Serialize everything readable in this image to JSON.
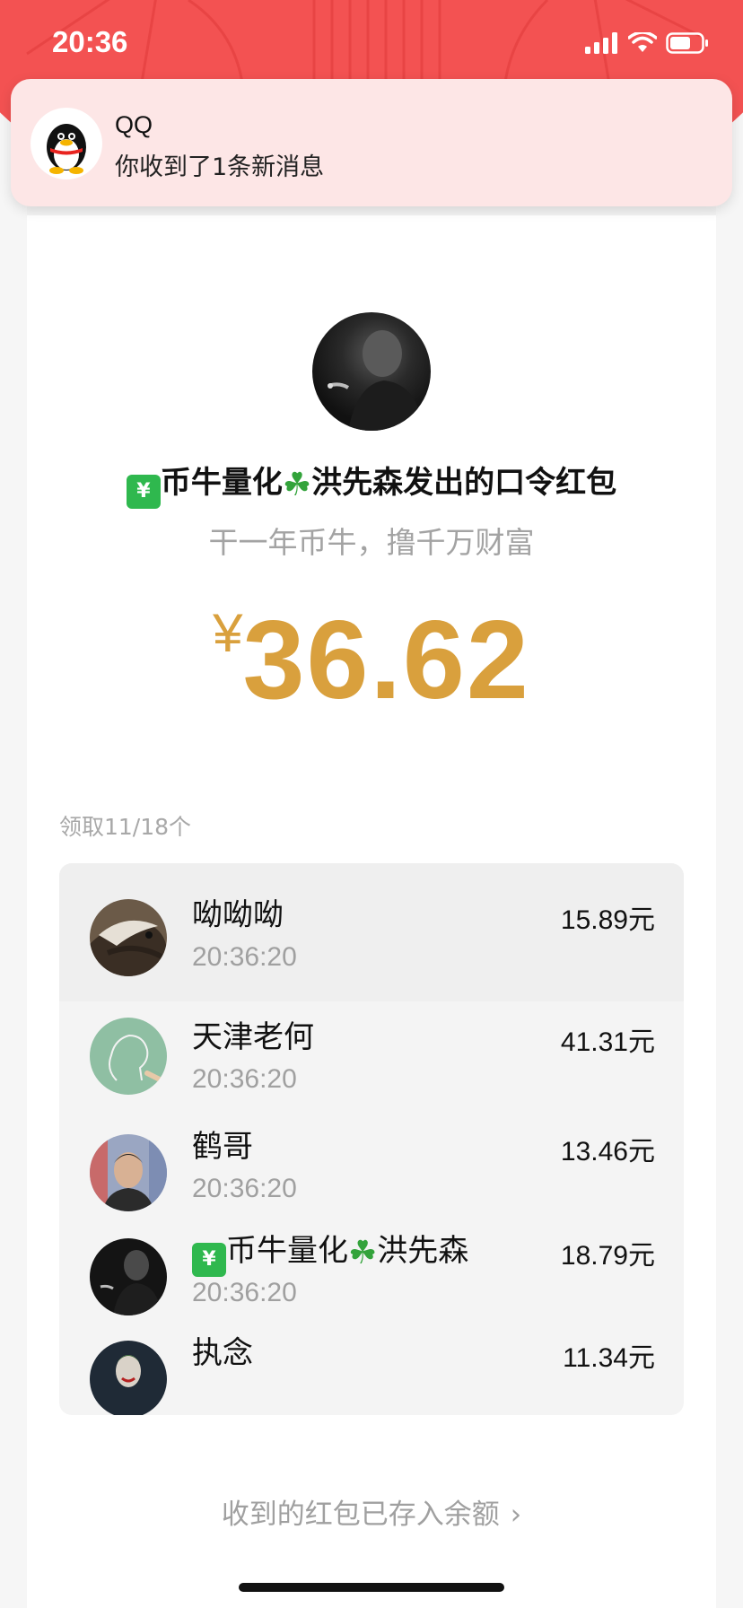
{
  "status_bar": {
    "time": "20:36"
  },
  "notification": {
    "app": "QQ",
    "message": "你收到了1条新消息",
    "icon": "qq-penguin-icon"
  },
  "packet": {
    "sender_title_prefix": "币牛量化",
    "sender_title_name": "洪先森",
    "sender_title_suffix": "发出的口令红包",
    "greeting": "干一年币牛，撸千万财富",
    "currency": "¥",
    "amount": "36.62",
    "claim_count": "领取11/18个",
    "badge_icon": "chart-badge-icon",
    "clover_icon": "four-leaf-clover-icon",
    "accent_color": "#d9a03d",
    "header_color": "#f35252"
  },
  "claims": [
    {
      "name": "呦呦呦",
      "time": "20:36:20",
      "amount": "15.89元",
      "avatar": "wolf-photo-avatar"
    },
    {
      "name": "天津老何",
      "time": "20:36:20",
      "amount": "41.31元",
      "avatar": "chalk-drawing-avatar"
    },
    {
      "name": "鹤哥",
      "time": "20:36:20",
      "amount": "13.46元",
      "avatar": "man-photo-avatar"
    },
    {
      "name_prefix": "币牛量化",
      "name_suffix": "洪先森",
      "time": "20:36:20",
      "amount": "18.79元",
      "avatar": "smoking-man-avatar"
    },
    {
      "name": "执念",
      "amount": "11.34元",
      "avatar": "joker-avatar"
    }
  ],
  "footer": {
    "link_label": "收到的红包已存入余额",
    "chevron": "›"
  }
}
